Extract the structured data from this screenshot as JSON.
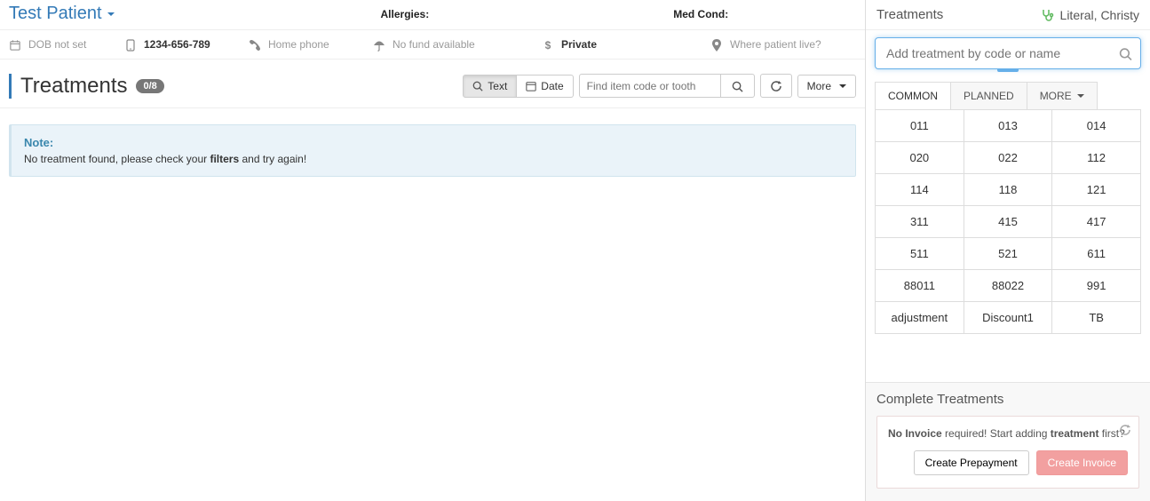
{
  "patient": {
    "name": "Test Patient",
    "allergies_label": "Allergies:",
    "medcond_label": "Med Cond:",
    "dob": "DOB not set",
    "phone": "1234-656-789",
    "home_phone": "Home phone",
    "fund": "No fund available",
    "payer": "Private",
    "address": "Where patient live?"
  },
  "main": {
    "title": "Treatments",
    "count_badge": "0/8",
    "btn_text": "Text",
    "btn_date": "Date",
    "search_placeholder": "Find item code or tooth",
    "btn_more": "More",
    "note_title": "Note:",
    "note_prefix": "No treatment found, please check your ",
    "note_bold": "filters",
    "note_suffix": " and try again!"
  },
  "sidebar": {
    "title": "Treatments",
    "practitioner": "Literal, Christy",
    "search_placeholder": "Add treatment by code or name",
    "tabs": {
      "common": "COMMON",
      "planned": "PLANNED",
      "more": "MORE"
    },
    "codes": [
      "011",
      "013",
      "014",
      "020",
      "022",
      "112",
      "114",
      "118",
      "121",
      "311",
      "415",
      "417",
      "511",
      "521",
      "611",
      "88011",
      "88022",
      "991",
      "adjustment",
      "Discount1",
      "TB"
    ],
    "footer": {
      "title": "Complete Treatments",
      "msg_prefix": "No Invoice",
      "msg_mid": " required! Start adding ",
      "msg_bold2": "treatment",
      "msg_suffix": " first?",
      "btn_prepay": "Create Prepayment",
      "btn_invoice": "Create Invoice"
    }
  }
}
